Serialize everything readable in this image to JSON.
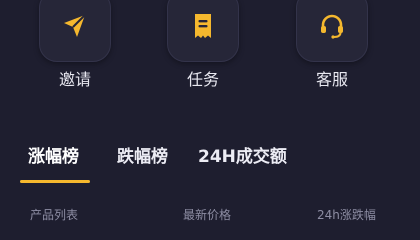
{
  "colors": {
    "background": "#1e1e2f",
    "tile": "#262638",
    "accent": "#f5b82e",
    "muted_text": "#8d8da3"
  },
  "quick_actions": [
    {
      "label": "邀请",
      "icon": "paper-plane-icon"
    },
    {
      "label": "任务",
      "icon": "task-receipt-icon"
    },
    {
      "label": "客服",
      "icon": "headset-icon"
    }
  ],
  "tabs": [
    {
      "label": "涨幅榜",
      "active": true
    },
    {
      "label": "跌幅榜",
      "active": false
    },
    {
      "label": "24H成交额",
      "active": false
    }
  ],
  "columns": {
    "product": "产品列表",
    "price": "最新价格",
    "change": "24h涨跌幅"
  }
}
